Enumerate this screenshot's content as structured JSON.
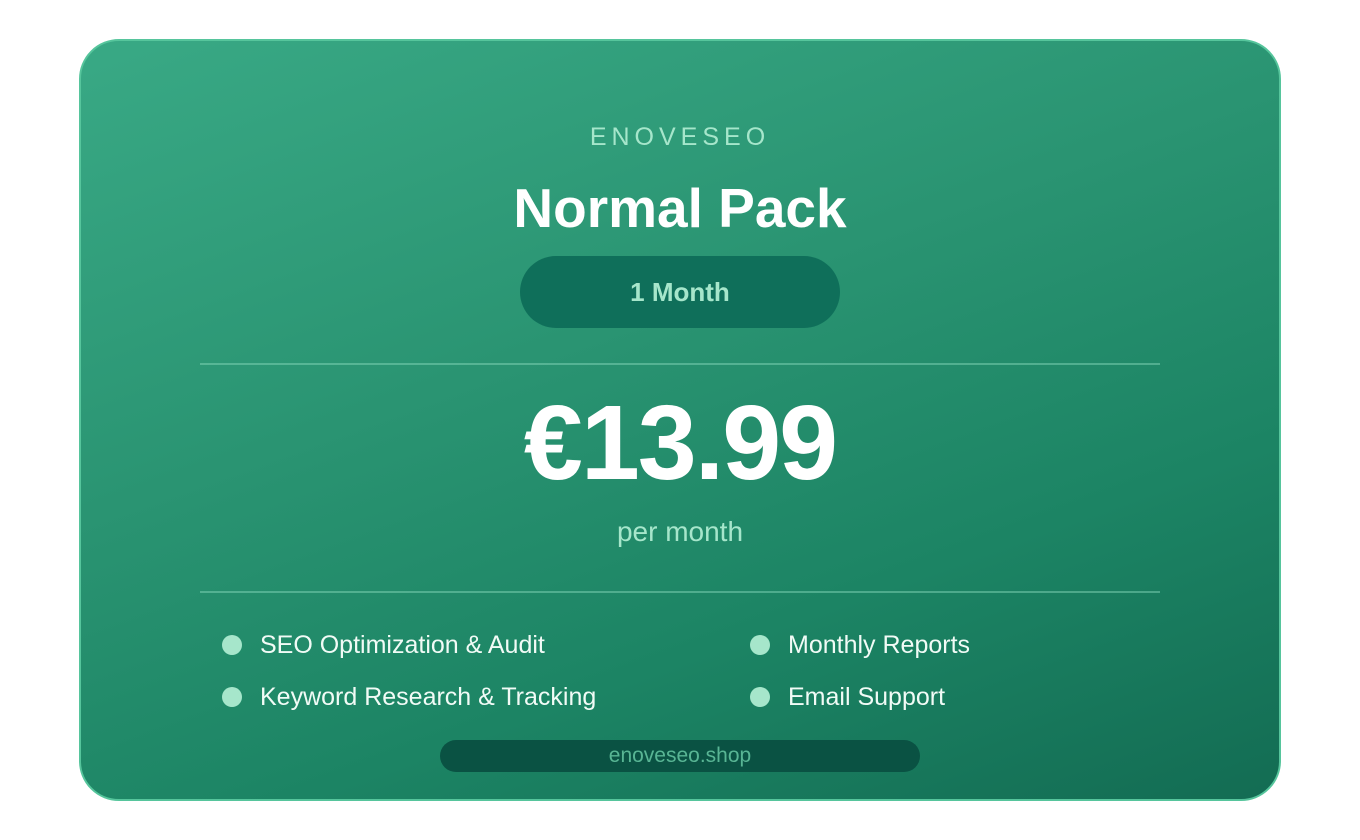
{
  "card": {
    "brand": "ENOVESEO",
    "title": "Normal Pack",
    "duration": "1 Month",
    "price": "€13.99",
    "period": "per month",
    "features": [
      "SEO Optimization & Audit",
      "Keyword Research & Tracking",
      "Monthly Reports",
      "Email Support"
    ],
    "url": "enoveseo.shop"
  },
  "colors": {
    "accent": "#a6e6cb",
    "card_gradient_start": "#39a985",
    "card_gradient_end": "#136c53",
    "border": "#56c59c",
    "pill_background": "#0f6f5a"
  },
  "icons": {
    "feature_bullet": "dot-icon"
  }
}
